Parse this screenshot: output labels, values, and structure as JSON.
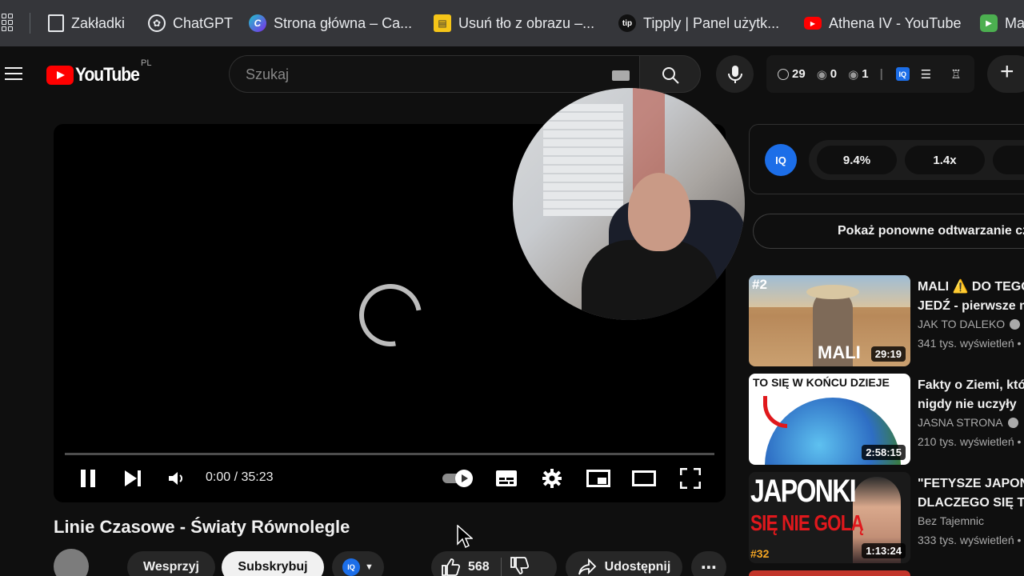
{
  "bookmarks": [
    {
      "label": "Zakładki",
      "icon": "bookmark-icon"
    },
    {
      "label": "ChatGPT",
      "icon": "chatgpt-icon"
    },
    {
      "label": "Strona główna – Ca...",
      "icon": "canva-icon"
    },
    {
      "label": "Usuń tło z obrazu –...",
      "icon": "removebg-icon"
    },
    {
      "label": "Tipply | Panel użytk...",
      "icon": "tipply-icon"
    },
    {
      "label": "Athena IV - YouTube",
      "icon": "youtube-icon"
    },
    {
      "label": "Ma",
      "icon": "play-icon"
    }
  ],
  "masthead": {
    "logo_text": "YouTube",
    "country_code": "PL",
    "search_placeholder": "Szukaj",
    "ext": {
      "history": "29",
      "watched": "0",
      "views": "1"
    }
  },
  "player": {
    "time": "0:00 / 35:23"
  },
  "video": {
    "title": "Linie Czasowe - Światy Równolegle",
    "support_label": "Wesprzyj",
    "subscribe_label": "Subskrybuj",
    "likes": "568",
    "share_label": "Udostępnij"
  },
  "sidebar": {
    "iq_logo": "IQ",
    "stats": [
      "9.4%",
      "1.4x"
    ],
    "replay_label": "Pokaż ponowne odtwarzanie cz",
    "recommendations": [
      {
        "title1": "MALI ⚠️ DO TEGO",
        "title2": "JEDŹ - pierwsze m",
        "channel": "JAK TO DALEKO",
        "views": "341 tys. wyświetleń •",
        "duration": "29:19",
        "thumb_text": "MALI",
        "badge": "#2"
      },
      {
        "title1": "Fakty o Ziemi, któ",
        "title2": "nigdy nie uczyły",
        "channel": "JASNA STRONA",
        "views": "210 tys. wyświetleń •",
        "duration": "2:58:15",
        "thumb_text": "TO SIĘ W KOŃCU DZIEJE",
        "badge": ""
      },
      {
        "title1": "\"FETYSZE JAPON",
        "title2": "DLACZEGO SIĘ TA",
        "channel": "Bez Tajemnic",
        "views": "333 tys. wyświetleń •",
        "duration": "1:13:24",
        "thumb_text": "JAPONKI",
        "thumb_text2": "SIĘ NIE GOLĄ",
        "badge": "#32"
      }
    ]
  },
  "colors": {
    "accent_red": "#ff0000",
    "iq_blue": "#1c6ee8",
    "bg": "#0f0f0f"
  }
}
